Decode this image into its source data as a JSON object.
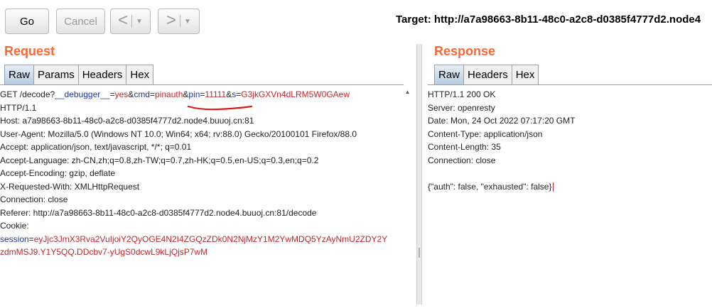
{
  "toolbar": {
    "go_label": "Go",
    "cancel_label": "Cancel",
    "back_arrow": "<",
    "forward_arrow": ">",
    "dropdown_caret": "▼",
    "target_text": "Target: http://a7a98663-8b11-48c0-a2c8-d0385f4777d2.node4"
  },
  "request": {
    "title": "Request",
    "tabs": [
      "Raw",
      "Params",
      "Headers",
      "Hex"
    ],
    "active_tab": "Raw",
    "line1": {
      "a": "GET /decode?",
      "b": "__debugger__",
      "c": "=",
      "d": "yes",
      "e": "&",
      "f": "cmd",
      "g": "=",
      "h": "pinauth",
      "i": "&",
      "j": "pin",
      "k": "=",
      "l": "11111",
      "m": "&",
      "n": "s",
      "o": "=",
      "p": "G3jkGXVn4dLRM5W0GAew"
    },
    "lines": [
      "HTTP/1.1",
      "Host: a7a98663-8b11-48c0-a2c8-d0385f4777d2.node4.buuoj.cn:81",
      "User-Agent: Mozilla/5.0 (Windows NT 10.0; Win64; x64; rv:88.0) Gecko/20100101 Firefox/88.0",
      "Accept: application/json, text/javascript, */*; q=0.01",
      "Accept-Language: zh-CN,zh;q=0.8,zh-TW;q=0.7,zh-HK;q=0.5,en-US;q=0.3,en;q=0.2",
      "Accept-Encoding: gzip, deflate",
      "X-Requested-With: XMLHttpRequest",
      "Connection: close",
      "Referer: http://a7a98663-8b11-48c0-a2c8-d0385f4777d2.node4.buuoj.cn:81/decode",
      "Cookie:"
    ],
    "cookie_name": "session",
    "cookie_eq": "=",
    "cookie_value_1": "eyJjc3JmX3Rva2VuIjoiY2QyOGE4N2I4ZGQzZDk0N2NjMzY1M2YwMDQ5YzAyNmU2ZDY2Y",
    "cookie_value_2": "zdmMSJ9.Y1Y5QQ.DDcbv7-yUgS0dcwL9kLjQjsP7wM"
  },
  "response": {
    "title": "Response",
    "tabs": [
      "Raw",
      "Headers",
      "Hex"
    ],
    "active_tab": "Raw",
    "lines": [
      "HTTP/1.1 200 OK",
      "Server: openresty",
      "Date: Mon, 24 Oct 2022 07:17:20 GMT",
      "Content-Type: application/json",
      "Content-Length: 35",
      "Connection: close",
      "",
      "{\"auth\": false, \"exhausted\": false}"
    ]
  },
  "colors": {
    "section_title": "#ff6633",
    "param_name": "#1a33b0",
    "param_value": "#c0282d",
    "annotation": "#d81c1c"
  }
}
